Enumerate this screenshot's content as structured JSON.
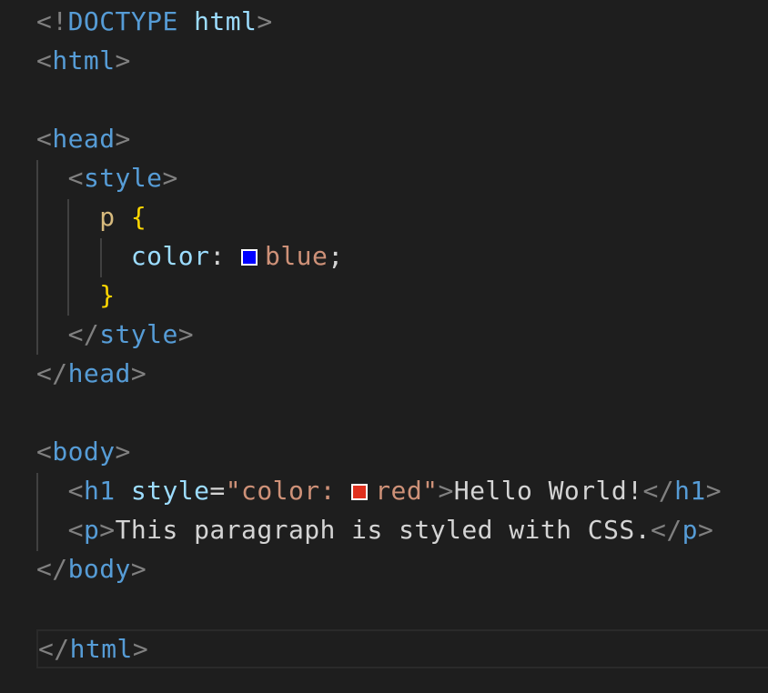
{
  "editor": {
    "colors": {
      "background": "#1e1e1e",
      "tag": "#569cd6",
      "punctuation": "#808080",
      "attribute": "#9cdcfe",
      "string": "#ce9178",
      "selector": "#d7ba7d",
      "brace": "#ffd700",
      "text": "#d4d4d4"
    },
    "lines": [
      {
        "open": "<!",
        "doctype": "DOCTYPE",
        "space": " ",
        "doctype_html": "html",
        "close": ">"
      },
      {
        "open": "<",
        "tag": "html",
        "close": ">"
      },
      {},
      {
        "open": "<",
        "tag": "head",
        "close": ">"
      },
      {
        "indent": "  ",
        "open": "<",
        "tag": "style",
        "close": ">"
      },
      {
        "indent": "    ",
        "selector": "p",
        "space": " ",
        "brace": "{"
      },
      {
        "indent": "      ",
        "property": "color",
        "colon": ": ",
        "swatch_color": "#0000ff",
        "value": "blue",
        "semicolon": ";"
      },
      {
        "indent": "    ",
        "brace": "}"
      },
      {
        "indent": "  ",
        "open": "</",
        "tag": "style",
        "close": ">"
      },
      {
        "open": "</",
        "tag": "head",
        "close": ">"
      },
      {},
      {
        "open": "<",
        "tag": "body",
        "close": ">"
      },
      {
        "indent": "  ",
        "open": "<",
        "tag": "h1",
        "space": " ",
        "attr": "style",
        "eq": "=",
        "quote_open": "\"",
        "style_text": "color: ",
        "swatch_color": "#e0301e",
        "value": "red",
        "quote_close": "\"",
        "close": ">",
        "text": "Hello World!",
        "end_open": "</",
        "end_tag": "h1",
        "end_close": ">"
      },
      {
        "indent": "  ",
        "open": "<",
        "tag": "p",
        "close": ">",
        "text": "This paragraph is styled with CSS.",
        "end_open": "</",
        "end_tag": "p",
        "end_close": ">"
      },
      {
        "open": "</",
        "tag": "body",
        "close": ">"
      },
      {},
      {
        "open": "</",
        "tag": "html",
        "close": ">"
      }
    ]
  }
}
